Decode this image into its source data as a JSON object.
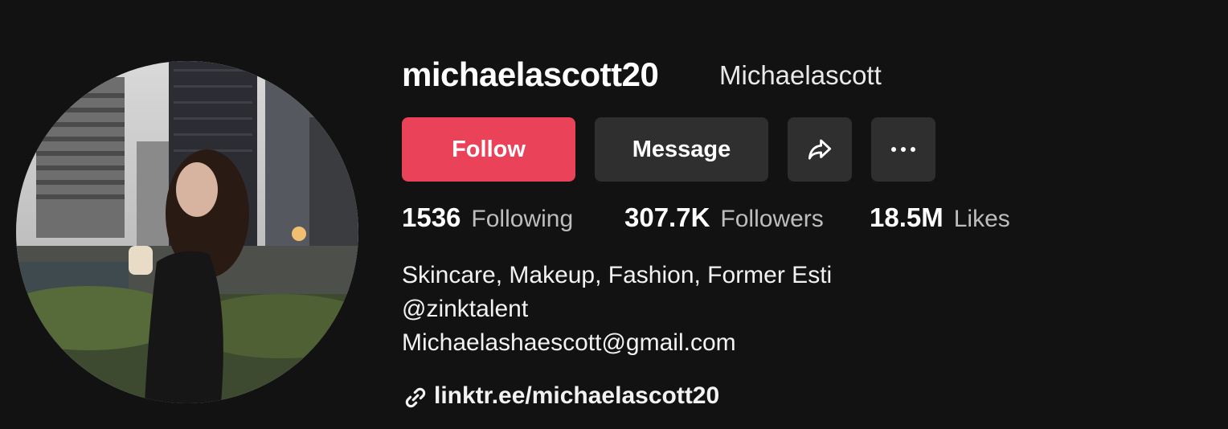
{
  "profile": {
    "username": "michaelascott20",
    "nickname": "Michaelascott"
  },
  "actions": {
    "follow_label": "Follow",
    "message_label": "Message",
    "share_icon": "share-arrow-icon",
    "more_icon": "more-horizontal-icon"
  },
  "stats": {
    "following": {
      "value": "1536",
      "label": "Following"
    },
    "followers": {
      "value": "307.7K",
      "label": "Followers"
    },
    "likes": {
      "value": "18.5M",
      "label": "Likes"
    }
  },
  "bio": {
    "lines": [
      "Skincare, Makeup, Fashion, Former Esti",
      "@zinktalent",
      "Michaelashaescott@gmail.com"
    ]
  },
  "link": {
    "text": "linktr.ee/michaelascott20",
    "icon": "link-icon"
  },
  "colors": {
    "background": "#121212",
    "follow_button": "#ea4359",
    "secondary_button": "#2f2f2f",
    "muted_text": "#bdbdbd"
  }
}
